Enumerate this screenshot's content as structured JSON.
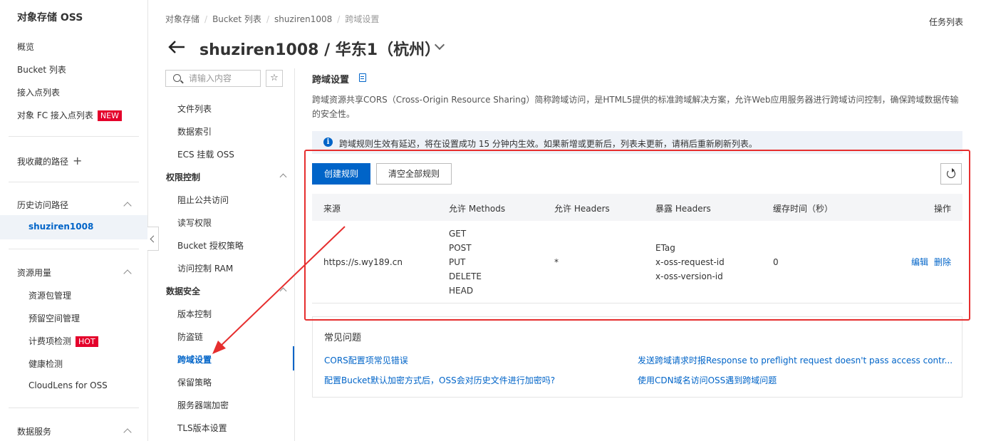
{
  "sidebar": {
    "title": "对象存储 OSS",
    "items": [
      {
        "label": "概览"
      },
      {
        "label": "Bucket 列表"
      },
      {
        "label": "接入点列表"
      },
      {
        "label": "对象 FC 接入点列表",
        "badge": "NEW"
      }
    ],
    "favorites_label": "我收藏的路径",
    "history_label": "历史访问路径",
    "history_current": "shuziren1008",
    "resource_label": "资源用量",
    "resource_items": [
      {
        "label": "资源包管理"
      },
      {
        "label": "预留空间管理"
      },
      {
        "label": "计费项检测",
        "badge": "HOT"
      },
      {
        "label": "健康检测"
      },
      {
        "label": "CloudLens for OSS"
      }
    ],
    "data_services_label": "数据服务"
  },
  "header": {
    "breadcrumb": [
      "对象存储",
      "Bucket 列表",
      "shuziren1008",
      "跨域设置"
    ],
    "task_list": "任务列表",
    "title": "shuziren1008 / 华东1（杭州）"
  },
  "nav2": {
    "search_placeholder": "请输入内容",
    "star": "☆",
    "items_top": [
      "文件列表",
      "数据索引",
      "ECS 挂载 OSS"
    ],
    "group_access": "权限控制",
    "items_access": [
      "阻止公共访问",
      "读写权限",
      "Bucket 授权策略",
      "访问控制 RAM"
    ],
    "group_security": "数据安全",
    "items_security": [
      "版本控制",
      "防盗链",
      "跨域设置",
      "保留策略",
      "服务器端加密",
      "TLS版本设置"
    ]
  },
  "main": {
    "section_title": "跨域设置",
    "description": "跨域资源共享CORS（Cross-Origin Resource Sharing）简称跨域访问，是HTML5提供的标准跨域解决方案，允许Web应用服务器进行跨域访问控制，确保跨域数据传输的安全性。",
    "info": "跨域规则生效有延迟，将在设置成功 15 分钟内生效。如果新增或更新后，列表未更新，请稍后重新刷新列表。",
    "create_button": "创建规则",
    "clear_button": "清空全部规则",
    "table": {
      "headers": [
        "来源",
        "允许 Methods",
        "允许 Headers",
        "暴露 Headers",
        "缓存时间（秒）",
        "操作"
      ],
      "row": {
        "origin": "https://s.wy189.cn",
        "methods": [
          "GET",
          "POST",
          "PUT",
          "DELETE",
          "HEAD"
        ],
        "allow_headers": "*",
        "expose_headers": [
          "ETag",
          "x-oss-request-id",
          "x-oss-version-id"
        ],
        "max_age": "0",
        "edit": "编辑",
        "delete": "删除"
      }
    },
    "faq": {
      "title": "常见问题",
      "links": [
        "CORS配置项常见错误",
        "发送跨域请求时报Response to preflight request doesn't pass access contr...",
        "配置Bucket默认加密方式后，OSS会对历史文件进行加密吗?",
        "使用CDN域名访问OSS遇到跨域问题"
      ]
    }
  },
  "colors": {
    "accent": "#0064c8",
    "annotation": "#e62e2e"
  }
}
